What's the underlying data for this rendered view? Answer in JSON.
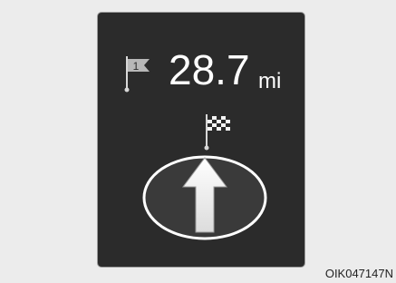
{
  "cluster": {
    "waypoint_number": "1",
    "distance_value": "28.7",
    "distance_unit": "mi",
    "waypoint_icon": "waypoint-flag-icon",
    "destination_icon": "checkered-flag-icon",
    "direction_icon": "straight-arrow-icon"
  },
  "caption": {
    "code": "OIK047147N"
  },
  "colors": {
    "screen_background": "#2b2b2b",
    "page_background": "#ececec",
    "text": "#ffffff",
    "flag_gray": "#b8b8b8"
  }
}
